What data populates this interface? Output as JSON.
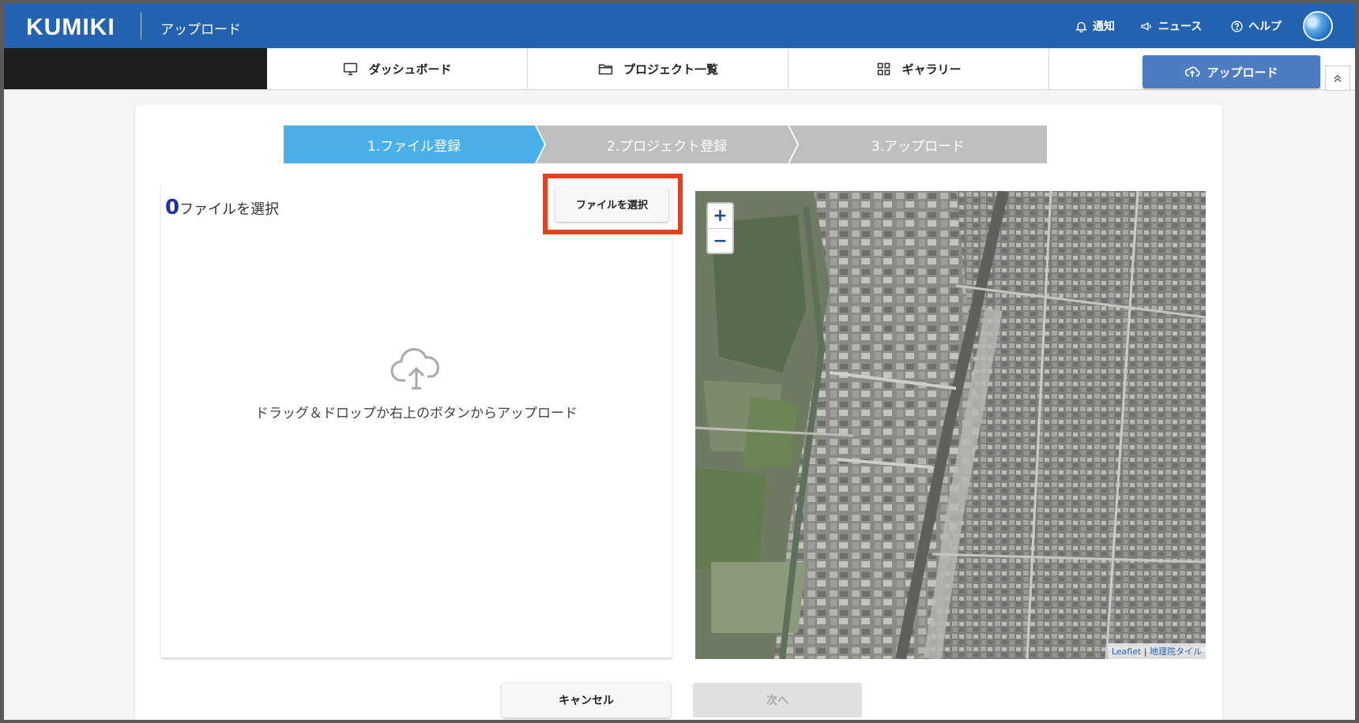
{
  "header": {
    "logo": "KUMIKI",
    "page_title": "アップロード",
    "links": {
      "notify": "通知",
      "news": "ニュース",
      "help": "ヘルプ"
    }
  },
  "nav": {
    "tabs": [
      {
        "label": "ダッシュボード",
        "icon": "monitor-icon"
      },
      {
        "label": "プロジェクト一覧",
        "icon": "folder-icon"
      },
      {
        "label": "ギャラリー",
        "icon": "grid-icon"
      }
    ],
    "upload_label": "アップロード"
  },
  "steps": [
    "1.ファイル登録",
    "2.プロジェクト登録",
    "3.アップロード"
  ],
  "file_panel": {
    "count": "0",
    "count_label": "ファイルを選択",
    "select_button": "ファイルを選択",
    "drop_text": "ドラッグ＆ドロップか右上のボタンからアップロード"
  },
  "map": {
    "zoom_in": "+",
    "zoom_out": "−",
    "attribution_leaflet": "Leaflet",
    "attribution_sep": " | ",
    "attribution_tiles": "地理院タイル"
  },
  "actions": {
    "cancel": "キャンセル",
    "next": "次へ"
  },
  "colors": {
    "header": "#2262ae",
    "step_active": "#4bb0e8",
    "step_inactive": "#bfbfbf",
    "highlight": "#e8401c",
    "primary_button": "#4d7dc0"
  }
}
